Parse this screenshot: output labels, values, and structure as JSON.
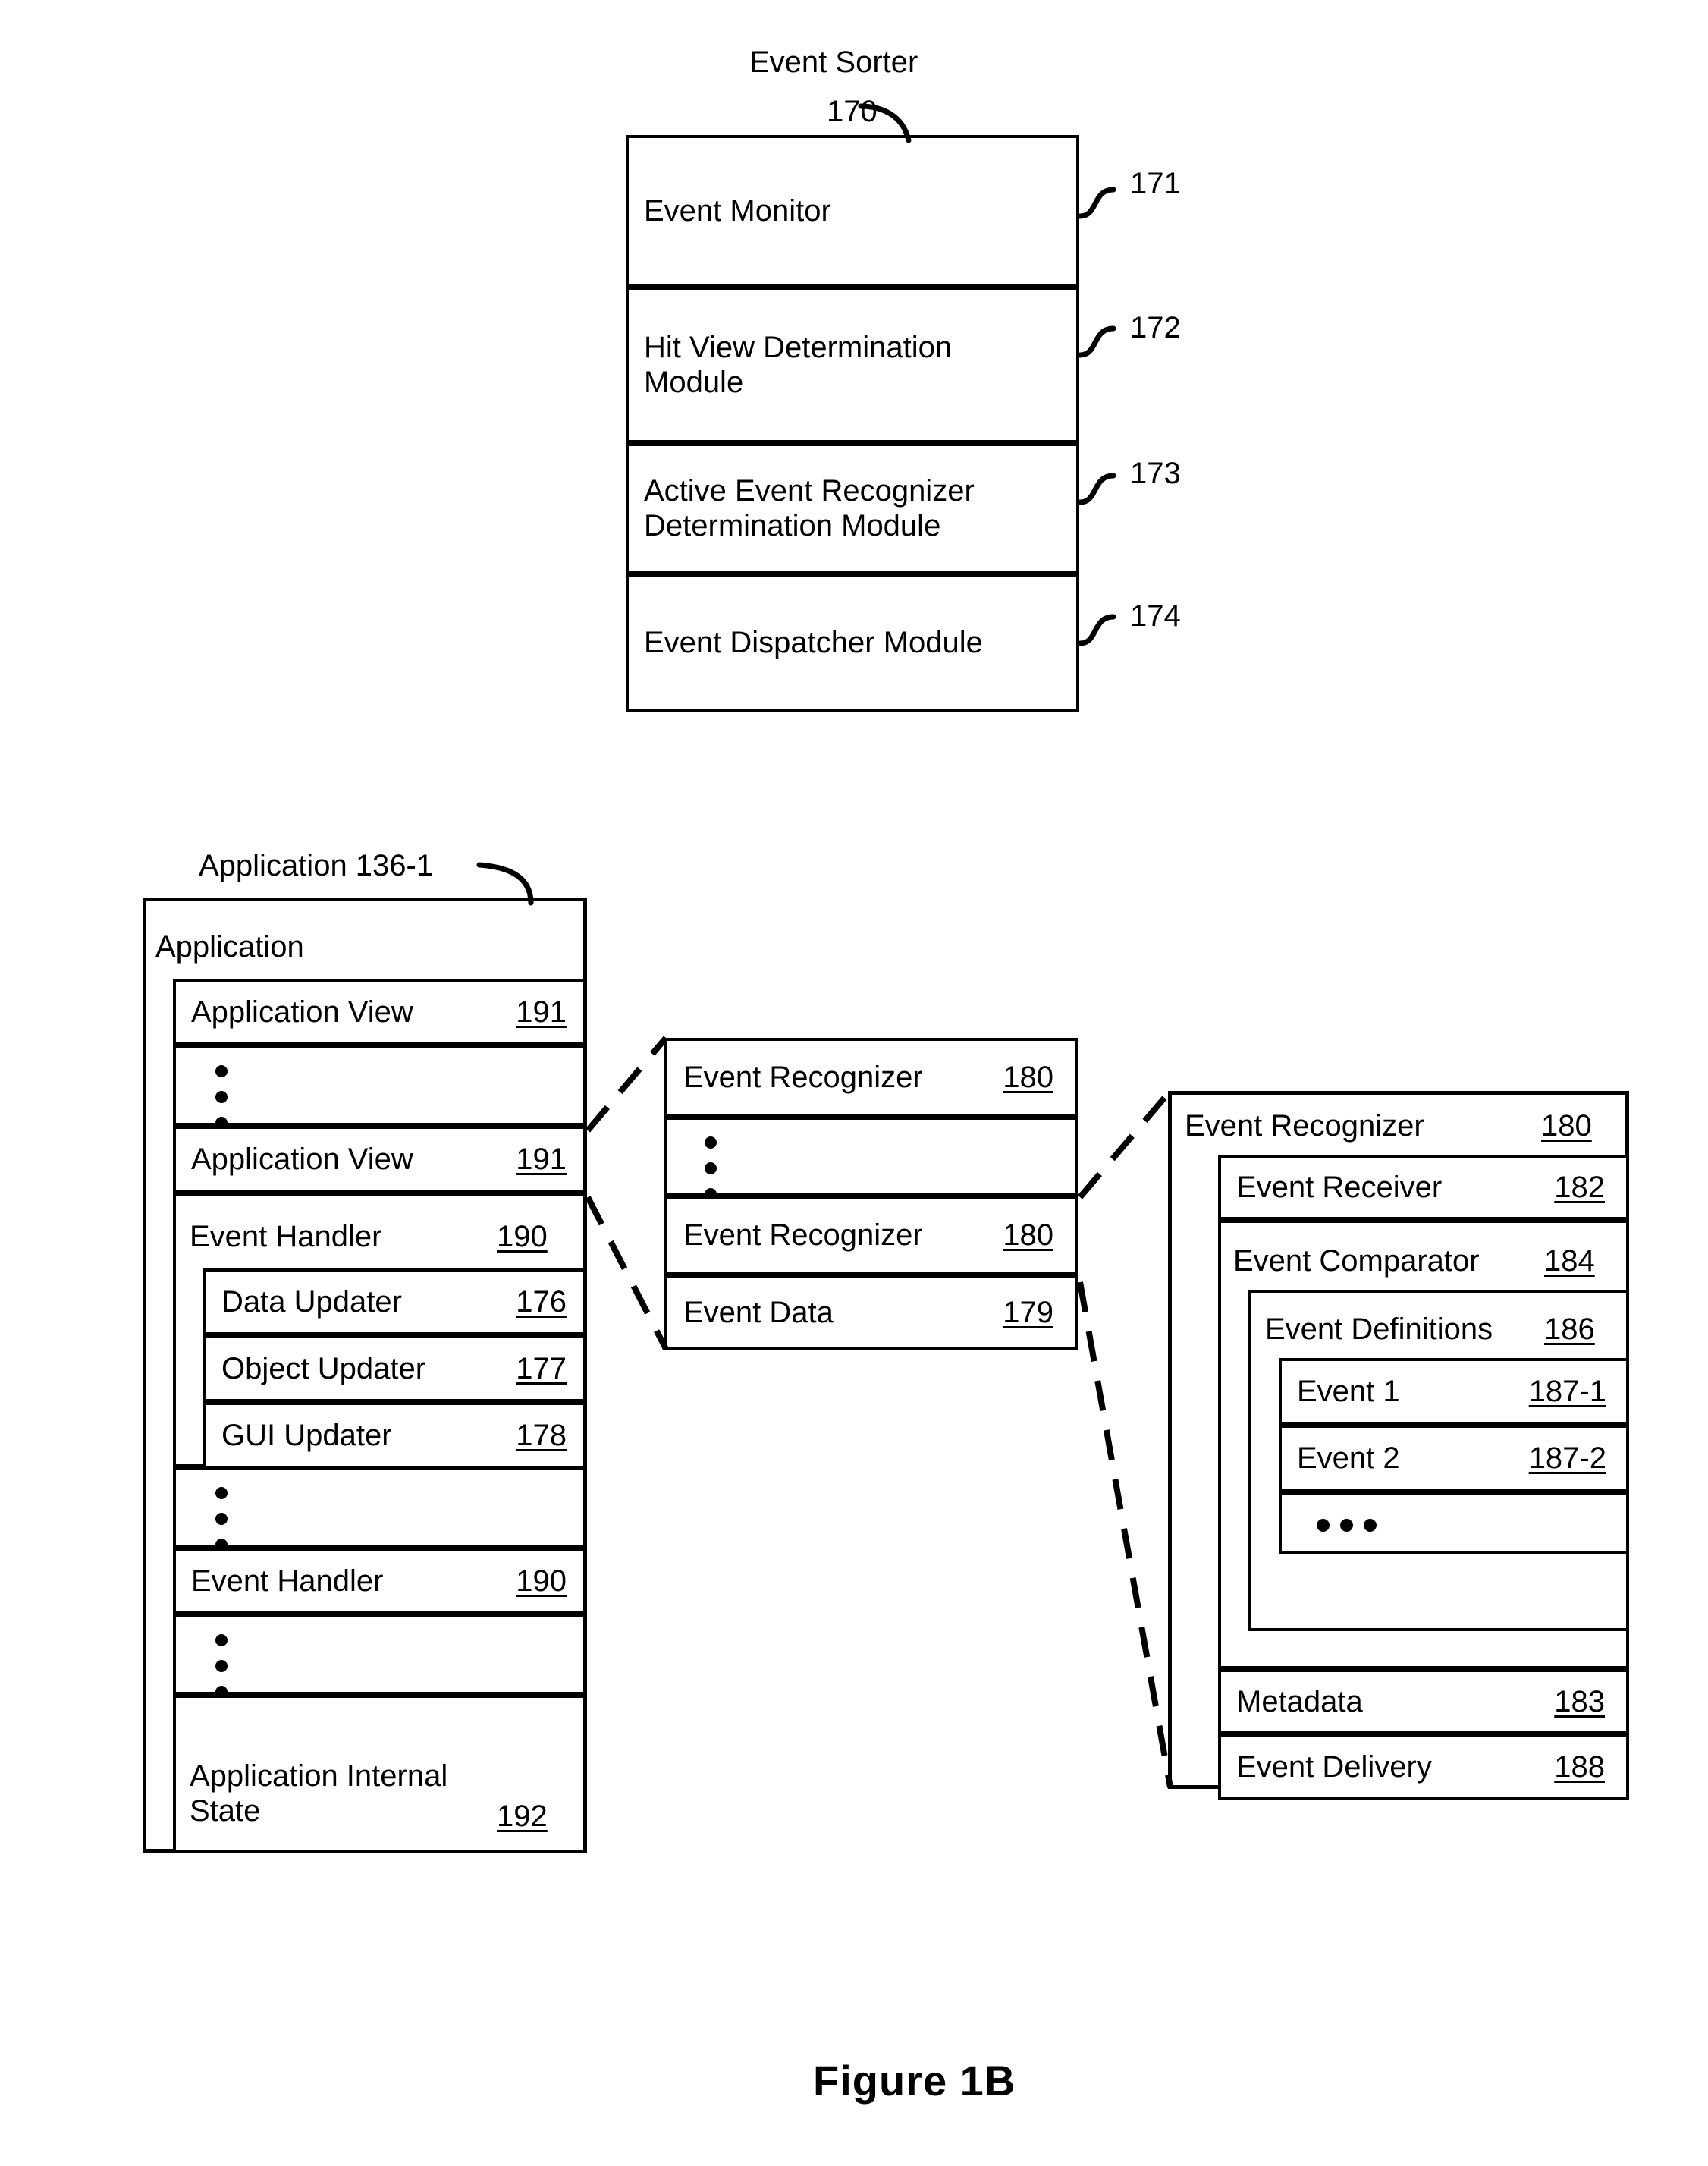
{
  "figure": {
    "caption": "Figure 1B"
  },
  "event_sorter": {
    "title": "Event Sorter",
    "ref": "170",
    "rows": [
      {
        "label": "Event Monitor",
        "ref": "171"
      },
      {
        "label": "Hit View Determination\nModule",
        "ref": "172"
      },
      {
        "label": "Active Event Recognizer\nDetermination Module",
        "ref": "173"
      },
      {
        "label": "Event Dispatcher Module",
        "ref": "174"
      }
    ]
  },
  "application": {
    "leader_label": "Application 136-1",
    "header": "Application",
    "rows": [
      {
        "label": "Application View",
        "ref": "191"
      },
      {
        "label": "",
        "ref": "",
        "ellipsis": "vertical"
      },
      {
        "label": "Application View",
        "ref": "191"
      },
      {
        "label": "Event Handler",
        "ref": "190"
      },
      {
        "label": "Data Updater",
        "ref": "176"
      },
      {
        "label": "Object Updater",
        "ref": "177"
      },
      {
        "label": "GUI Updater",
        "ref": "178"
      },
      {
        "label": "",
        "ref": "",
        "ellipsis": "vertical"
      },
      {
        "label": "Event Handler",
        "ref": "190"
      },
      {
        "label": "",
        "ref": "",
        "ellipsis": "vertical"
      },
      {
        "label": "Application Internal\nState",
        "ref": "192"
      }
    ]
  },
  "recognizer_list": {
    "rows": [
      {
        "label": "Event Recognizer",
        "ref": "180"
      },
      {
        "label": "",
        "ref": "",
        "ellipsis": "vertical"
      },
      {
        "label": "Event Recognizer",
        "ref": "180"
      },
      {
        "label": "Event Data",
        "ref": "179"
      }
    ]
  },
  "recognizer_detail": {
    "header": {
      "label": "Event Recognizer",
      "ref": "180"
    },
    "rows": [
      {
        "label": "Event Receiver",
        "ref": "182"
      },
      {
        "label": "Event Comparator",
        "ref": "184"
      },
      {
        "label": "Event Definitions",
        "ref": "186"
      },
      {
        "label": "Event 1",
        "ref": "187-1"
      },
      {
        "label": "Event 2",
        "ref": "187-2"
      },
      {
        "label": "",
        "ref": "",
        "ellipsis": "horizontal"
      },
      {
        "label": "Metadata",
        "ref": "183"
      },
      {
        "label": "Event Delivery",
        "ref": "188"
      }
    ]
  },
  "colors": {
    "line": "#000000",
    "background": "#ffffff"
  }
}
